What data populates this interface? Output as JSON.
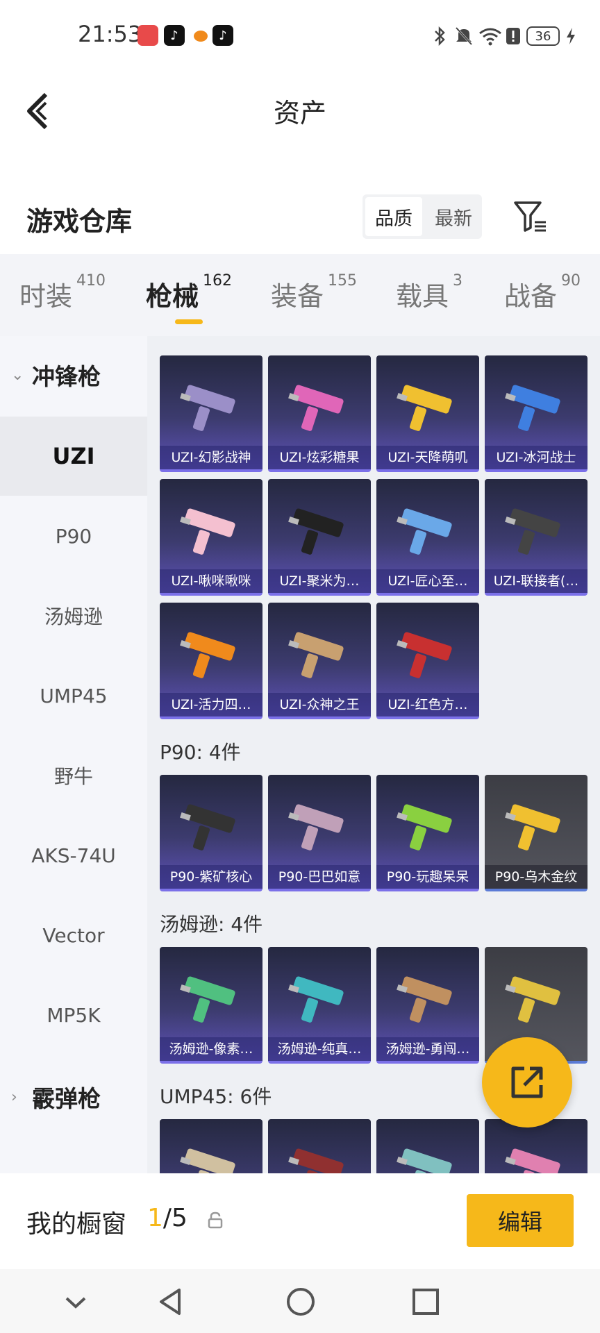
{
  "status_bar": {
    "time": "21:53",
    "battery": "36"
  },
  "header": {
    "title": "资产"
  },
  "section": {
    "title": "游戏仓库",
    "sort_options": [
      "品质",
      "最新"
    ]
  },
  "tabs": [
    {
      "label": "时装",
      "count": "410"
    },
    {
      "label": "枪械",
      "count": "162"
    },
    {
      "label": "装备",
      "count": "155"
    },
    {
      "label": "载具",
      "count": "3"
    },
    {
      "label": "战备",
      "count": "90"
    }
  ],
  "sidebar": {
    "category_smg": "冲锋枪",
    "items": [
      "UZI",
      "P90",
      "汤姆逊",
      "UMP45",
      "野牛",
      "AKS-74U",
      "Vector",
      "MP5K"
    ],
    "category_shotgun": "霰弹枪"
  },
  "groups": {
    "uzi": {
      "items": [
        "UZI-幻影战神",
        "UZI-炫彩糖果",
        "UZI-天降萌叽",
        "UZI-冰河战士",
        "UZI-啾咪啾咪",
        "UZI-聚米为…",
        "UZI-匠心至…",
        "UZI-联接者(…",
        "UZI-活力四…",
        "UZI-众神之王",
        "UZI-红色方…"
      ]
    },
    "p90": {
      "label": "P90: 4件",
      "items": [
        "P90-紫矿核心",
        "P90-巴巴如意",
        "P90-玩趣呆呆",
        "P90-乌木金纹"
      ]
    },
    "thompson": {
      "label": "汤姆逊: 4件",
      "items": [
        "汤姆逊-像素…",
        "汤姆逊-纯真…",
        "汤姆逊-勇闯…"
      ]
    },
    "ump45": {
      "label": "UMP45: 6件"
    }
  },
  "bottom": {
    "title": "我的橱窗",
    "count_current": "1",
    "count_total": "/5",
    "edit_label": "编辑"
  },
  "colors": {
    "accent": "#f6b81a",
    "card_purple": "#5e52b8",
    "card_gray": "#55565e"
  }
}
